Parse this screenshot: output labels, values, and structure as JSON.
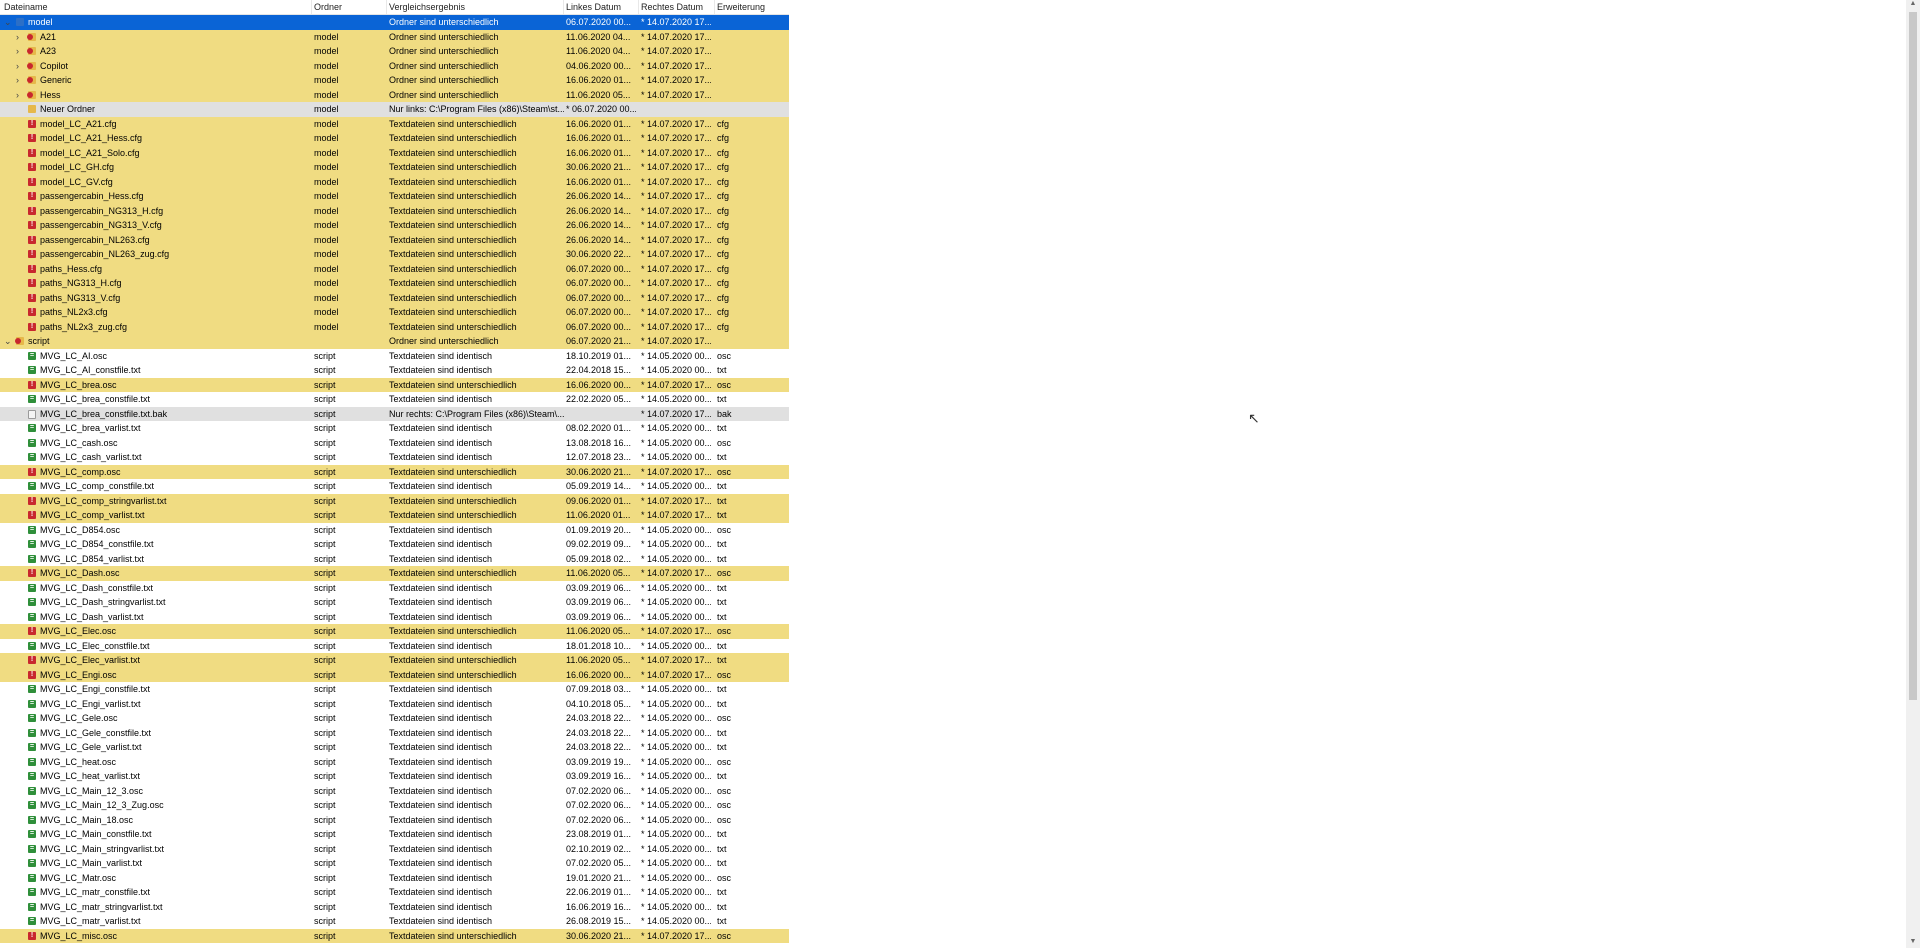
{
  "columns": {
    "name": "Dateiname",
    "folder": "Ordner",
    "result": "Vergleichsergebnis",
    "left_date": "Linkes Datum",
    "right_date": "Rechtes Datum",
    "ext": "Erweiterung"
  },
  "colors": {
    "diff": "#f0dc82",
    "only": "#e0e0e0",
    "selected": "#0a64d6"
  },
  "rows": [
    {
      "name": "model",
      "folder": "",
      "result": "Ordner sind unterschiedlich",
      "left": "06.07.2020 00...",
      "right": "* 14.07.2020 17...",
      "ext": "",
      "kind": "sel",
      "icon": "bluefld",
      "indent": 0,
      "exp": "v"
    },
    {
      "name": "A21",
      "folder": "model",
      "result": "Ordner sind unterschiedlich",
      "left": "11.06.2020 04...",
      "right": "* 14.07.2020 17...",
      "ext": "",
      "kind": "diff",
      "icon": "folderred",
      "indent": 1,
      "exp": ">"
    },
    {
      "name": "A23",
      "folder": "model",
      "result": "Ordner sind unterschiedlich",
      "left": "11.06.2020 04...",
      "right": "* 14.07.2020 17...",
      "ext": "",
      "kind": "diff",
      "icon": "folderred",
      "indent": 1,
      "exp": ">"
    },
    {
      "name": "Copilot",
      "folder": "model",
      "result": "Ordner sind unterschiedlich",
      "left": "04.06.2020 00...",
      "right": "* 14.07.2020 17...",
      "ext": "",
      "kind": "diff",
      "icon": "folderred",
      "indent": 1,
      "exp": ">"
    },
    {
      "name": "Generic",
      "folder": "model",
      "result": "Ordner sind unterschiedlich",
      "left": "16.06.2020 01...",
      "right": "* 14.07.2020 17...",
      "ext": "",
      "kind": "diff",
      "icon": "folderred",
      "indent": 1,
      "exp": ">"
    },
    {
      "name": "Hess",
      "folder": "model",
      "result": "Ordner sind unterschiedlich",
      "left": "11.06.2020 05...",
      "right": "* 14.07.2020 17...",
      "ext": "",
      "kind": "diff",
      "icon": "folderred",
      "indent": 1,
      "exp": ">"
    },
    {
      "name": "Neuer Ordner",
      "folder": "model",
      "result": "Nur links: C:\\Program Files (x86)\\Steam\\st...",
      "left": "* 06.07.2020 00...",
      "right": "",
      "ext": "",
      "kind": "only",
      "icon": "folder",
      "indent": 1,
      "exp": ""
    },
    {
      "name": "model_LC_A21.cfg",
      "folder": "model",
      "result": "Textdateien sind unterschiedlich",
      "left": "16.06.2020 01...",
      "right": "* 14.07.2020 17...",
      "ext": "cfg",
      "kind": "diff",
      "icon": "red",
      "indent": 1,
      "exp": ""
    },
    {
      "name": "model_LC_A21_Hess.cfg",
      "folder": "model",
      "result": "Textdateien sind unterschiedlich",
      "left": "16.06.2020 01...",
      "right": "* 14.07.2020 17...",
      "ext": "cfg",
      "kind": "diff",
      "icon": "red",
      "indent": 1,
      "exp": ""
    },
    {
      "name": "model_LC_A21_Solo.cfg",
      "folder": "model",
      "result": "Textdateien sind unterschiedlich",
      "left": "16.06.2020 01...",
      "right": "* 14.07.2020 17...",
      "ext": "cfg",
      "kind": "diff",
      "icon": "red",
      "indent": 1,
      "exp": ""
    },
    {
      "name": "model_LC_GH.cfg",
      "folder": "model",
      "result": "Textdateien sind unterschiedlich",
      "left": "30.06.2020 21...",
      "right": "* 14.07.2020 17...",
      "ext": "cfg",
      "kind": "diff",
      "icon": "red",
      "indent": 1,
      "exp": ""
    },
    {
      "name": "model_LC_GV.cfg",
      "folder": "model",
      "result": "Textdateien sind unterschiedlich",
      "left": "16.06.2020 01...",
      "right": "* 14.07.2020 17...",
      "ext": "cfg",
      "kind": "diff",
      "icon": "red",
      "indent": 1,
      "exp": ""
    },
    {
      "name": "passengercabin_Hess.cfg",
      "folder": "model",
      "result": "Textdateien sind unterschiedlich",
      "left": "26.06.2020 14...",
      "right": "* 14.07.2020 17...",
      "ext": "cfg",
      "kind": "diff",
      "icon": "red",
      "indent": 1,
      "exp": ""
    },
    {
      "name": "passengercabin_NG313_H.cfg",
      "folder": "model",
      "result": "Textdateien sind unterschiedlich",
      "left": "26.06.2020 14...",
      "right": "* 14.07.2020 17...",
      "ext": "cfg",
      "kind": "diff",
      "icon": "red",
      "indent": 1,
      "exp": ""
    },
    {
      "name": "passengercabin_NG313_V.cfg",
      "folder": "model",
      "result": "Textdateien sind unterschiedlich",
      "left": "26.06.2020 14...",
      "right": "* 14.07.2020 17...",
      "ext": "cfg",
      "kind": "diff",
      "icon": "red",
      "indent": 1,
      "exp": ""
    },
    {
      "name": "passengercabin_NL263.cfg",
      "folder": "model",
      "result": "Textdateien sind unterschiedlich",
      "left": "26.06.2020 14...",
      "right": "* 14.07.2020 17...",
      "ext": "cfg",
      "kind": "diff",
      "icon": "red",
      "indent": 1,
      "exp": ""
    },
    {
      "name": "passengercabin_NL263_zug.cfg",
      "folder": "model",
      "result": "Textdateien sind unterschiedlich",
      "left": "30.06.2020 22...",
      "right": "* 14.07.2020 17...",
      "ext": "cfg",
      "kind": "diff",
      "icon": "red",
      "indent": 1,
      "exp": ""
    },
    {
      "name": "paths_Hess.cfg",
      "folder": "model",
      "result": "Textdateien sind unterschiedlich",
      "left": "06.07.2020 00...",
      "right": "* 14.07.2020 17...",
      "ext": "cfg",
      "kind": "diff",
      "icon": "red",
      "indent": 1,
      "exp": ""
    },
    {
      "name": "paths_NG313_H.cfg",
      "folder": "model",
      "result": "Textdateien sind unterschiedlich",
      "left": "06.07.2020 00...",
      "right": "* 14.07.2020 17...",
      "ext": "cfg",
      "kind": "diff",
      "icon": "red",
      "indent": 1,
      "exp": ""
    },
    {
      "name": "paths_NG313_V.cfg",
      "folder": "model",
      "result": "Textdateien sind unterschiedlich",
      "left": "06.07.2020 00...",
      "right": "* 14.07.2020 17...",
      "ext": "cfg",
      "kind": "diff",
      "icon": "red",
      "indent": 1,
      "exp": ""
    },
    {
      "name": "paths_NL2x3.cfg",
      "folder": "model",
      "result": "Textdateien sind unterschiedlich",
      "left": "06.07.2020 00...",
      "right": "* 14.07.2020 17...",
      "ext": "cfg",
      "kind": "diff",
      "icon": "red",
      "indent": 1,
      "exp": ""
    },
    {
      "name": "paths_NL2x3_zug.cfg",
      "folder": "model",
      "result": "Textdateien sind unterschiedlich",
      "left": "06.07.2020 00...",
      "right": "* 14.07.2020 17...",
      "ext": "cfg",
      "kind": "diff",
      "icon": "red",
      "indent": 1,
      "exp": ""
    },
    {
      "name": "script",
      "folder": "",
      "result": "Ordner sind unterschiedlich",
      "left": "06.07.2020 21...",
      "right": "* 14.07.2020 17...",
      "ext": "",
      "kind": "diff",
      "icon": "folderred",
      "indent": 0,
      "exp": "v"
    },
    {
      "name": "MVG_LC_AI.osc",
      "folder": "script",
      "result": "Textdateien sind identisch",
      "left": "18.10.2019 01...",
      "right": "* 14.05.2020 00...",
      "ext": "osc",
      "kind": "same",
      "icon": "green",
      "indent": 1,
      "exp": ""
    },
    {
      "name": "MVG_LC_AI_constfile.txt",
      "folder": "script",
      "result": "Textdateien sind identisch",
      "left": "22.04.2018 15...",
      "right": "* 14.05.2020 00...",
      "ext": "txt",
      "kind": "same",
      "icon": "green",
      "indent": 1,
      "exp": ""
    },
    {
      "name": "MVG_LC_brea.osc",
      "folder": "script",
      "result": "Textdateien sind unterschiedlich",
      "left": "16.06.2020 00...",
      "right": "* 14.07.2020 17...",
      "ext": "osc",
      "kind": "diff",
      "icon": "red",
      "indent": 1,
      "exp": ""
    },
    {
      "name": "MVG_LC_brea_constfile.txt",
      "folder": "script",
      "result": "Textdateien sind identisch",
      "left": "22.02.2020 05...",
      "right": "* 14.05.2020 00...",
      "ext": "txt",
      "kind": "same",
      "icon": "green",
      "indent": 1,
      "exp": ""
    },
    {
      "name": "MVG_LC_brea_constfile.txt.bak",
      "folder": "script",
      "result": "Nur rechts: C:\\Program Files (x86)\\Steam\\...",
      "left": "",
      "right": "* 14.07.2020 17...",
      "ext": "bak",
      "kind": "only",
      "icon": "file",
      "indent": 1,
      "exp": ""
    },
    {
      "name": "MVG_LC_brea_varlist.txt",
      "folder": "script",
      "result": "Textdateien sind identisch",
      "left": "08.02.2020 01...",
      "right": "* 14.05.2020 00...",
      "ext": "txt",
      "kind": "same",
      "icon": "green",
      "indent": 1,
      "exp": ""
    },
    {
      "name": "MVG_LC_cash.osc",
      "folder": "script",
      "result": "Textdateien sind identisch",
      "left": "13.08.2018 16...",
      "right": "* 14.05.2020 00...",
      "ext": "osc",
      "kind": "same",
      "icon": "green",
      "indent": 1,
      "exp": ""
    },
    {
      "name": "MVG_LC_cash_varlist.txt",
      "folder": "script",
      "result": "Textdateien sind identisch",
      "left": "12.07.2018 23...",
      "right": "* 14.05.2020 00...",
      "ext": "txt",
      "kind": "same",
      "icon": "green",
      "indent": 1,
      "exp": ""
    },
    {
      "name": "MVG_LC_comp.osc",
      "folder": "script",
      "result": "Textdateien sind unterschiedlich",
      "left": "30.06.2020 21...",
      "right": "* 14.07.2020 17...",
      "ext": "osc",
      "kind": "diff",
      "icon": "red",
      "indent": 1,
      "exp": ""
    },
    {
      "name": "MVG_LC_comp_constfile.txt",
      "folder": "script",
      "result": "Textdateien sind identisch",
      "left": "05.09.2019 14...",
      "right": "* 14.05.2020 00...",
      "ext": "txt",
      "kind": "same",
      "icon": "green",
      "indent": 1,
      "exp": ""
    },
    {
      "name": "MVG_LC_comp_stringvarlist.txt",
      "folder": "script",
      "result": "Textdateien sind unterschiedlich",
      "left": "09.06.2020 01...",
      "right": "* 14.07.2020 17...",
      "ext": "txt",
      "kind": "diff",
      "icon": "red",
      "indent": 1,
      "exp": ""
    },
    {
      "name": "MVG_LC_comp_varlist.txt",
      "folder": "script",
      "result": "Textdateien sind unterschiedlich",
      "left": "11.06.2020 01...",
      "right": "* 14.07.2020 17...",
      "ext": "txt",
      "kind": "diff",
      "icon": "red",
      "indent": 1,
      "exp": ""
    },
    {
      "name": "MVG_LC_D854.osc",
      "folder": "script",
      "result": "Textdateien sind identisch",
      "left": "01.09.2019 20...",
      "right": "* 14.05.2020 00...",
      "ext": "osc",
      "kind": "same",
      "icon": "green",
      "indent": 1,
      "exp": ""
    },
    {
      "name": "MVG_LC_D854_constfile.txt",
      "folder": "script",
      "result": "Textdateien sind identisch",
      "left": "09.02.2019 09...",
      "right": "* 14.05.2020 00...",
      "ext": "txt",
      "kind": "same",
      "icon": "green",
      "indent": 1,
      "exp": ""
    },
    {
      "name": "MVG_LC_D854_varlist.txt",
      "folder": "script",
      "result": "Textdateien sind identisch",
      "left": "05.09.2018 02...",
      "right": "* 14.05.2020 00...",
      "ext": "txt",
      "kind": "same",
      "icon": "green",
      "indent": 1,
      "exp": ""
    },
    {
      "name": "MVG_LC_Dash.osc",
      "folder": "script",
      "result": "Textdateien sind unterschiedlich",
      "left": "11.06.2020 05...",
      "right": "* 14.07.2020 17...",
      "ext": "osc",
      "kind": "diff",
      "icon": "red",
      "indent": 1,
      "exp": ""
    },
    {
      "name": "MVG_LC_Dash_constfile.txt",
      "folder": "script",
      "result": "Textdateien sind identisch",
      "left": "03.09.2019 06...",
      "right": "* 14.05.2020 00...",
      "ext": "txt",
      "kind": "same",
      "icon": "green",
      "indent": 1,
      "exp": ""
    },
    {
      "name": "MVG_LC_Dash_stringvarlist.txt",
      "folder": "script",
      "result": "Textdateien sind identisch",
      "left": "03.09.2019 06...",
      "right": "* 14.05.2020 00...",
      "ext": "txt",
      "kind": "same",
      "icon": "green",
      "indent": 1,
      "exp": ""
    },
    {
      "name": "MVG_LC_Dash_varlist.txt",
      "folder": "script",
      "result": "Textdateien sind identisch",
      "left": "03.09.2019 06...",
      "right": "* 14.05.2020 00...",
      "ext": "txt",
      "kind": "same",
      "icon": "green",
      "indent": 1,
      "exp": ""
    },
    {
      "name": "MVG_LC_Elec.osc",
      "folder": "script",
      "result": "Textdateien sind unterschiedlich",
      "left": "11.06.2020 05...",
      "right": "* 14.07.2020 17...",
      "ext": "osc",
      "kind": "diff",
      "icon": "red",
      "indent": 1,
      "exp": ""
    },
    {
      "name": "MVG_LC_Elec_constfile.txt",
      "folder": "script",
      "result": "Textdateien sind identisch",
      "left": "18.01.2018 10...",
      "right": "* 14.05.2020 00...",
      "ext": "txt",
      "kind": "same",
      "icon": "green",
      "indent": 1,
      "exp": ""
    },
    {
      "name": "MVG_LC_Elec_varlist.txt",
      "folder": "script",
      "result": "Textdateien sind unterschiedlich",
      "left": "11.06.2020 05...",
      "right": "* 14.07.2020 17...",
      "ext": "txt",
      "kind": "diff",
      "icon": "red",
      "indent": 1,
      "exp": ""
    },
    {
      "name": "MVG_LC_Engi.osc",
      "folder": "script",
      "result": "Textdateien sind unterschiedlich",
      "left": "16.06.2020 00...",
      "right": "* 14.07.2020 17...",
      "ext": "osc",
      "kind": "diff",
      "icon": "red",
      "indent": 1,
      "exp": ""
    },
    {
      "name": "MVG_LC_Engi_constfile.txt",
      "folder": "script",
      "result": "Textdateien sind identisch",
      "left": "07.09.2018 03...",
      "right": "* 14.05.2020 00...",
      "ext": "txt",
      "kind": "same",
      "icon": "green",
      "indent": 1,
      "exp": ""
    },
    {
      "name": "MVG_LC_Engi_varlist.txt",
      "folder": "script",
      "result": "Textdateien sind identisch",
      "left": "04.10.2018 05...",
      "right": "* 14.05.2020 00...",
      "ext": "txt",
      "kind": "same",
      "icon": "green",
      "indent": 1,
      "exp": ""
    },
    {
      "name": "MVG_LC_Gele.osc",
      "folder": "script",
      "result": "Textdateien sind identisch",
      "left": "24.03.2018 22...",
      "right": "* 14.05.2020 00...",
      "ext": "osc",
      "kind": "same",
      "icon": "green",
      "indent": 1,
      "exp": ""
    },
    {
      "name": "MVG_LC_Gele_constfile.txt",
      "folder": "script",
      "result": "Textdateien sind identisch",
      "left": "24.03.2018 22...",
      "right": "* 14.05.2020 00...",
      "ext": "txt",
      "kind": "same",
      "icon": "green",
      "indent": 1,
      "exp": ""
    },
    {
      "name": "MVG_LC_Gele_varlist.txt",
      "folder": "script",
      "result": "Textdateien sind identisch",
      "left": "24.03.2018 22...",
      "right": "* 14.05.2020 00...",
      "ext": "txt",
      "kind": "same",
      "icon": "green",
      "indent": 1,
      "exp": ""
    },
    {
      "name": "MVG_LC_heat.osc",
      "folder": "script",
      "result": "Textdateien sind identisch",
      "left": "03.09.2019 19...",
      "right": "* 14.05.2020 00...",
      "ext": "osc",
      "kind": "same",
      "icon": "green",
      "indent": 1,
      "exp": ""
    },
    {
      "name": "MVG_LC_heat_varlist.txt",
      "folder": "script",
      "result": "Textdateien sind identisch",
      "left": "03.09.2019 16...",
      "right": "* 14.05.2020 00...",
      "ext": "txt",
      "kind": "same",
      "icon": "green",
      "indent": 1,
      "exp": ""
    },
    {
      "name": "MVG_LC_Main_12_3.osc",
      "folder": "script",
      "result": "Textdateien sind identisch",
      "left": "07.02.2020 06...",
      "right": "* 14.05.2020 00...",
      "ext": "osc",
      "kind": "same",
      "icon": "green",
      "indent": 1,
      "exp": ""
    },
    {
      "name": "MVG_LC_Main_12_3_Zug.osc",
      "folder": "script",
      "result": "Textdateien sind identisch",
      "left": "07.02.2020 06...",
      "right": "* 14.05.2020 00...",
      "ext": "osc",
      "kind": "same",
      "icon": "green",
      "indent": 1,
      "exp": ""
    },
    {
      "name": "MVG_LC_Main_18.osc",
      "folder": "script",
      "result": "Textdateien sind identisch",
      "left": "07.02.2020 06...",
      "right": "* 14.05.2020 00...",
      "ext": "osc",
      "kind": "same",
      "icon": "green",
      "indent": 1,
      "exp": ""
    },
    {
      "name": "MVG_LC_Main_constfile.txt",
      "folder": "script",
      "result": "Textdateien sind identisch",
      "left": "23.08.2019 01...",
      "right": "* 14.05.2020 00...",
      "ext": "txt",
      "kind": "same",
      "icon": "green",
      "indent": 1,
      "exp": ""
    },
    {
      "name": "MVG_LC_Main_stringvarlist.txt",
      "folder": "script",
      "result": "Textdateien sind identisch",
      "left": "02.10.2019 02...",
      "right": "* 14.05.2020 00...",
      "ext": "txt",
      "kind": "same",
      "icon": "green",
      "indent": 1,
      "exp": ""
    },
    {
      "name": "MVG_LC_Main_varlist.txt",
      "folder": "script",
      "result": "Textdateien sind identisch",
      "left": "07.02.2020 05...",
      "right": "* 14.05.2020 00...",
      "ext": "txt",
      "kind": "same",
      "icon": "green",
      "indent": 1,
      "exp": ""
    },
    {
      "name": "MVG_LC_Matr.osc",
      "folder": "script",
      "result": "Textdateien sind identisch",
      "left": "19.01.2020 21...",
      "right": "* 14.05.2020 00...",
      "ext": "osc",
      "kind": "same",
      "icon": "green",
      "indent": 1,
      "exp": ""
    },
    {
      "name": "MVG_LC_matr_constfile.txt",
      "folder": "script",
      "result": "Textdateien sind identisch",
      "left": "22.06.2019 01...",
      "right": "* 14.05.2020 00...",
      "ext": "txt",
      "kind": "same",
      "icon": "green",
      "indent": 1,
      "exp": ""
    },
    {
      "name": "MVG_LC_matr_stringvarlist.txt",
      "folder": "script",
      "result": "Textdateien sind identisch",
      "left": "16.06.2019 16...",
      "right": "* 14.05.2020 00...",
      "ext": "txt",
      "kind": "same",
      "icon": "green",
      "indent": 1,
      "exp": ""
    },
    {
      "name": "MVG_LC_matr_varlist.txt",
      "folder": "script",
      "result": "Textdateien sind identisch",
      "left": "26.08.2019 15...",
      "right": "* 14.05.2020 00...",
      "ext": "txt",
      "kind": "same",
      "icon": "green",
      "indent": 1,
      "exp": ""
    },
    {
      "name": "MVG_LC_misc.osc",
      "folder": "script",
      "result": "Textdateien sind unterschiedlich",
      "left": "30.06.2020 21...",
      "right": "* 14.07.2020 17...",
      "ext": "osc",
      "kind": "diff",
      "icon": "red",
      "indent": 1,
      "exp": ""
    }
  ]
}
